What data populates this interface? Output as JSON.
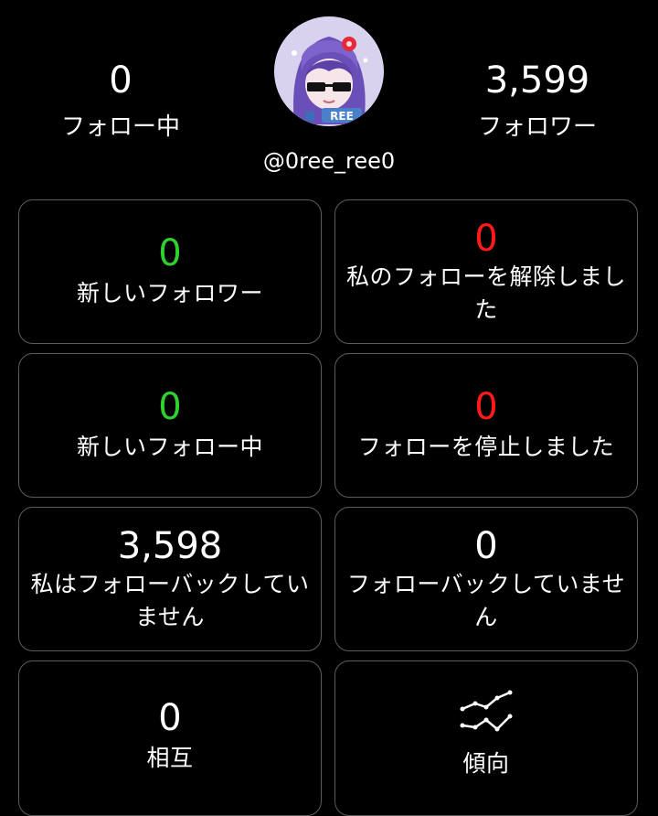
{
  "profile": {
    "following_count": "0",
    "following_label": "フォロー中",
    "followers_count": "3,599",
    "followers_label": "フォロワー",
    "username": "@0ree_ree0",
    "avatar_icon": "profile-avatar-icon",
    "avatar_text": "REE"
  },
  "cards": [
    {
      "value": "0",
      "label": "新しいフォロワー",
      "color": "#2fd12f"
    },
    {
      "value": "0",
      "label": "私のフォローを解除しました",
      "color": "#ff1a1a"
    },
    {
      "value": "0",
      "label": "新しいフォロー中",
      "color": "#2fd12f"
    },
    {
      "value": "0",
      "label": "フォローを停止しました",
      "color": "#ff1a1a"
    },
    {
      "value": "3,598",
      "label": "私はフォローバックしていません",
      "color": "#ffffff"
    },
    {
      "value": "0",
      "label": "フォローバックしていません",
      "color": "#ffffff"
    },
    {
      "value": "0",
      "label": "相互",
      "color": "#ffffff"
    },
    {
      "label": "傾向",
      "icon": "trend-chart-icon"
    }
  ],
  "theme": {
    "background": "#000000",
    "card_border": "#5c5c5c",
    "positive": "#2fd12f",
    "negative": "#ff1a1a"
  }
}
